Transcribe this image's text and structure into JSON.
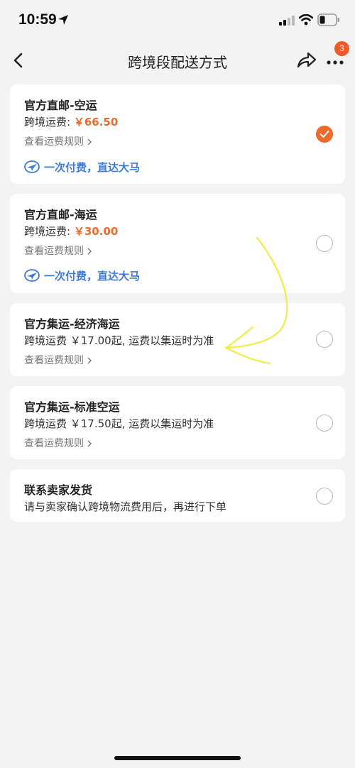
{
  "status_bar": {
    "time": "10:59"
  },
  "nav": {
    "title": "跨境段配送方式",
    "more_badge": "3"
  },
  "options": [
    {
      "title": "官方直邮-空运",
      "fee_label": "跨境运费: ",
      "fee_price": "￥66.50",
      "rule_link": "查看运费规则",
      "promo": "一次付费，直达大马",
      "selected": true
    },
    {
      "title": "官方直邮-海运",
      "fee_label": "跨境运费: ",
      "fee_price": "￥30.00",
      "rule_link": "查看运费规则",
      "promo": "一次付费，直达大马",
      "selected": false
    },
    {
      "title": "官方集运-经济海运",
      "fee_text": "跨境运费 ￥17.00起, 运费以集运时为准",
      "rule_link": "查看运费规则",
      "selected": false
    },
    {
      "title": "官方集运-标准空运",
      "fee_text": "跨境运费 ￥17.50起, 运费以集运时为准",
      "rule_link": "查看运费规则",
      "selected": false
    },
    {
      "title": "联系卖家发货",
      "fee_text": "请与卖家确认跨境物流费用后，再进行下单",
      "selected": false
    }
  ],
  "colors": {
    "accent": "#ee6a2a",
    "promo": "#3f7ad6",
    "background": "#f3f3f3"
  },
  "icons": {
    "back": "chevron-left-icon",
    "share": "share-icon",
    "more": "more-dots-icon",
    "promo": "plane-badge-icon",
    "check": "check-icon"
  }
}
